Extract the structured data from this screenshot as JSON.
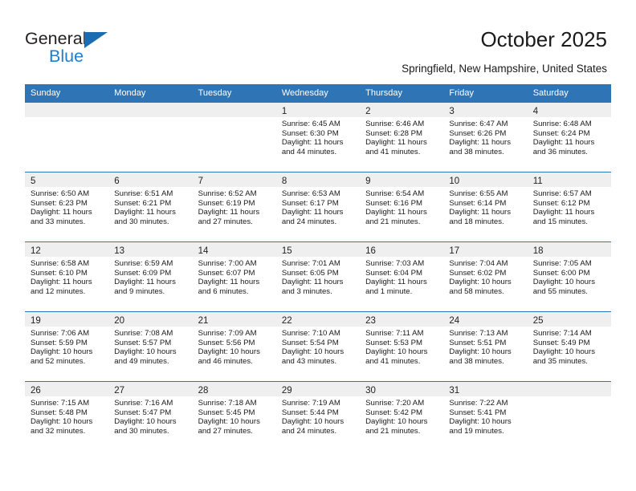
{
  "brand": {
    "name_part1": "General",
    "name_part2": "Blue",
    "triangle_icon": "blue-triangle-icon",
    "colors": {
      "dark": "#231f20",
      "blue": "#1b7fd4",
      "triangle": "#1b6cb0"
    }
  },
  "header": {
    "title": "October 2025",
    "location": "Springfield, New Hampshire, United States"
  },
  "theme": {
    "header_blue": "#2f75b5",
    "daynum_band": "#efefef",
    "text": "#1a1a1a"
  },
  "weekdays": [
    "Sunday",
    "Monday",
    "Tuesday",
    "Wednesday",
    "Thursday",
    "Friday",
    "Saturday"
  ],
  "labels": {
    "sunrise": "Sunrise:",
    "sunset": "Sunset:",
    "daylight": "Daylight:"
  },
  "weeks": [
    [
      {
        "day": ""
      },
      {
        "day": ""
      },
      {
        "day": ""
      },
      {
        "day": "1",
        "sunrise": "Sunrise: 6:45 AM",
        "sunset": "Sunset: 6:30 PM",
        "daylight": "Daylight: 11 hours and 44 minutes."
      },
      {
        "day": "2",
        "sunrise": "Sunrise: 6:46 AM",
        "sunset": "Sunset: 6:28 PM",
        "daylight": "Daylight: 11 hours and 41 minutes."
      },
      {
        "day": "3",
        "sunrise": "Sunrise: 6:47 AM",
        "sunset": "Sunset: 6:26 PM",
        "daylight": "Daylight: 11 hours and 38 minutes."
      },
      {
        "day": "4",
        "sunrise": "Sunrise: 6:48 AM",
        "sunset": "Sunset: 6:24 PM",
        "daylight": "Daylight: 11 hours and 36 minutes."
      }
    ],
    [
      {
        "day": "5",
        "sunrise": "Sunrise: 6:50 AM",
        "sunset": "Sunset: 6:23 PM",
        "daylight": "Daylight: 11 hours and 33 minutes."
      },
      {
        "day": "6",
        "sunrise": "Sunrise: 6:51 AM",
        "sunset": "Sunset: 6:21 PM",
        "daylight": "Daylight: 11 hours and 30 minutes."
      },
      {
        "day": "7",
        "sunrise": "Sunrise: 6:52 AM",
        "sunset": "Sunset: 6:19 PM",
        "daylight": "Daylight: 11 hours and 27 minutes."
      },
      {
        "day": "8",
        "sunrise": "Sunrise: 6:53 AM",
        "sunset": "Sunset: 6:17 PM",
        "daylight": "Daylight: 11 hours and 24 minutes."
      },
      {
        "day": "9",
        "sunrise": "Sunrise: 6:54 AM",
        "sunset": "Sunset: 6:16 PM",
        "daylight": "Daylight: 11 hours and 21 minutes."
      },
      {
        "day": "10",
        "sunrise": "Sunrise: 6:55 AM",
        "sunset": "Sunset: 6:14 PM",
        "daylight": "Daylight: 11 hours and 18 minutes."
      },
      {
        "day": "11",
        "sunrise": "Sunrise: 6:57 AM",
        "sunset": "Sunset: 6:12 PM",
        "daylight": "Daylight: 11 hours and 15 minutes."
      }
    ],
    [
      {
        "day": "12",
        "sunrise": "Sunrise: 6:58 AM",
        "sunset": "Sunset: 6:10 PM",
        "daylight": "Daylight: 11 hours and 12 minutes."
      },
      {
        "day": "13",
        "sunrise": "Sunrise: 6:59 AM",
        "sunset": "Sunset: 6:09 PM",
        "daylight": "Daylight: 11 hours and 9 minutes."
      },
      {
        "day": "14",
        "sunrise": "Sunrise: 7:00 AM",
        "sunset": "Sunset: 6:07 PM",
        "daylight": "Daylight: 11 hours and 6 minutes."
      },
      {
        "day": "15",
        "sunrise": "Sunrise: 7:01 AM",
        "sunset": "Sunset: 6:05 PM",
        "daylight": "Daylight: 11 hours and 3 minutes."
      },
      {
        "day": "16",
        "sunrise": "Sunrise: 7:03 AM",
        "sunset": "Sunset: 6:04 PM",
        "daylight": "Daylight: 11 hours and 1 minute."
      },
      {
        "day": "17",
        "sunrise": "Sunrise: 7:04 AM",
        "sunset": "Sunset: 6:02 PM",
        "daylight": "Daylight: 10 hours and 58 minutes."
      },
      {
        "day": "18",
        "sunrise": "Sunrise: 7:05 AM",
        "sunset": "Sunset: 6:00 PM",
        "daylight": "Daylight: 10 hours and 55 minutes."
      }
    ],
    [
      {
        "day": "19",
        "sunrise": "Sunrise: 7:06 AM",
        "sunset": "Sunset: 5:59 PM",
        "daylight": "Daylight: 10 hours and 52 minutes."
      },
      {
        "day": "20",
        "sunrise": "Sunrise: 7:08 AM",
        "sunset": "Sunset: 5:57 PM",
        "daylight": "Daylight: 10 hours and 49 minutes."
      },
      {
        "day": "21",
        "sunrise": "Sunrise: 7:09 AM",
        "sunset": "Sunset: 5:56 PM",
        "daylight": "Daylight: 10 hours and 46 minutes."
      },
      {
        "day": "22",
        "sunrise": "Sunrise: 7:10 AM",
        "sunset": "Sunset: 5:54 PM",
        "daylight": "Daylight: 10 hours and 43 minutes."
      },
      {
        "day": "23",
        "sunrise": "Sunrise: 7:11 AM",
        "sunset": "Sunset: 5:53 PM",
        "daylight": "Daylight: 10 hours and 41 minutes."
      },
      {
        "day": "24",
        "sunrise": "Sunrise: 7:13 AM",
        "sunset": "Sunset: 5:51 PM",
        "daylight": "Daylight: 10 hours and 38 minutes."
      },
      {
        "day": "25",
        "sunrise": "Sunrise: 7:14 AM",
        "sunset": "Sunset: 5:49 PM",
        "daylight": "Daylight: 10 hours and 35 minutes."
      }
    ],
    [
      {
        "day": "26",
        "sunrise": "Sunrise: 7:15 AM",
        "sunset": "Sunset: 5:48 PM",
        "daylight": "Daylight: 10 hours and 32 minutes."
      },
      {
        "day": "27",
        "sunrise": "Sunrise: 7:16 AM",
        "sunset": "Sunset: 5:47 PM",
        "daylight": "Daylight: 10 hours and 30 minutes."
      },
      {
        "day": "28",
        "sunrise": "Sunrise: 7:18 AM",
        "sunset": "Sunset: 5:45 PM",
        "daylight": "Daylight: 10 hours and 27 minutes."
      },
      {
        "day": "29",
        "sunrise": "Sunrise: 7:19 AM",
        "sunset": "Sunset: 5:44 PM",
        "daylight": "Daylight: 10 hours and 24 minutes."
      },
      {
        "day": "30",
        "sunrise": "Sunrise: 7:20 AM",
        "sunset": "Sunset: 5:42 PM",
        "daylight": "Daylight: 10 hours and 21 minutes."
      },
      {
        "day": "31",
        "sunrise": "Sunrise: 7:22 AM",
        "sunset": "Sunset: 5:41 PM",
        "daylight": "Daylight: 10 hours and 19 minutes."
      },
      {
        "day": ""
      }
    ]
  ]
}
